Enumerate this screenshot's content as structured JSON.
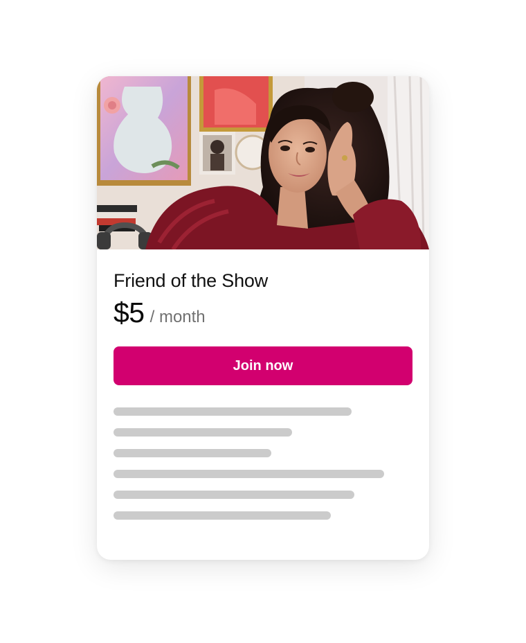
{
  "tier": {
    "name": "Friend of the Show",
    "price": "$5",
    "period": "/ month",
    "cta_label": "Join now"
  },
  "colors": {
    "accent": "#d2006f",
    "skeleton": "#cbcbcb",
    "card_background": "#ffffff"
  },
  "hero_image": {
    "icon": "creator-photo"
  },
  "benefit_placeholders": [
    {
      "fill": 0.8
    },
    {
      "fill": 0.6
    },
    {
      "fill": 0.53
    },
    {
      "fill": 0.91
    },
    {
      "fill": 0.81
    },
    {
      "fill": 0.73
    }
  ]
}
